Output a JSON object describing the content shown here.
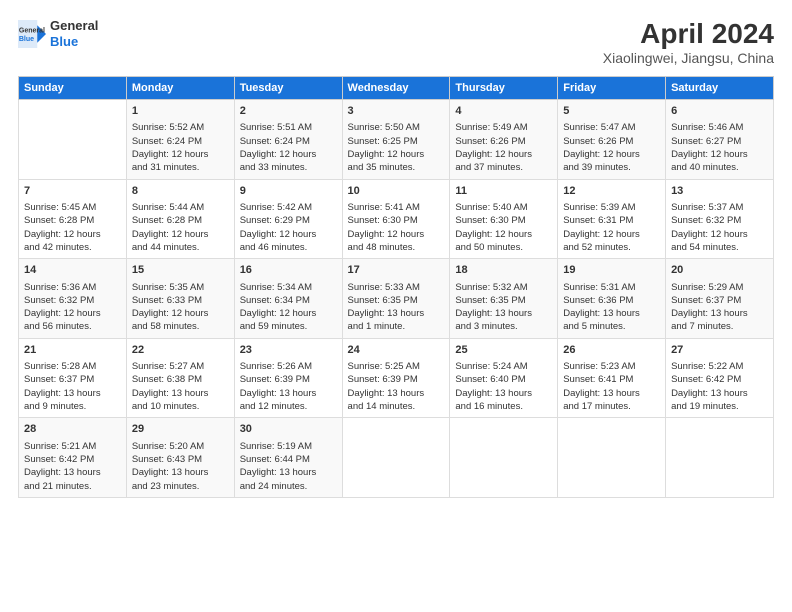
{
  "header": {
    "logo_line1": "General",
    "logo_line2": "Blue",
    "title": "April 2024",
    "subtitle": "Xiaolingwei, Jiangsu, China"
  },
  "columns": [
    "Sunday",
    "Monday",
    "Tuesday",
    "Wednesday",
    "Thursday",
    "Friday",
    "Saturday"
  ],
  "rows": [
    [
      {
        "num": "",
        "lines": []
      },
      {
        "num": "1",
        "lines": [
          "Sunrise: 5:52 AM",
          "Sunset: 6:24 PM",
          "Daylight: 12 hours",
          "and 31 minutes."
        ]
      },
      {
        "num": "2",
        "lines": [
          "Sunrise: 5:51 AM",
          "Sunset: 6:24 PM",
          "Daylight: 12 hours",
          "and 33 minutes."
        ]
      },
      {
        "num": "3",
        "lines": [
          "Sunrise: 5:50 AM",
          "Sunset: 6:25 PM",
          "Daylight: 12 hours",
          "and 35 minutes."
        ]
      },
      {
        "num": "4",
        "lines": [
          "Sunrise: 5:49 AM",
          "Sunset: 6:26 PM",
          "Daylight: 12 hours",
          "and 37 minutes."
        ]
      },
      {
        "num": "5",
        "lines": [
          "Sunrise: 5:47 AM",
          "Sunset: 6:26 PM",
          "Daylight: 12 hours",
          "and 39 minutes."
        ]
      },
      {
        "num": "6",
        "lines": [
          "Sunrise: 5:46 AM",
          "Sunset: 6:27 PM",
          "Daylight: 12 hours",
          "and 40 minutes."
        ]
      }
    ],
    [
      {
        "num": "7",
        "lines": [
          "Sunrise: 5:45 AM",
          "Sunset: 6:28 PM",
          "Daylight: 12 hours",
          "and 42 minutes."
        ]
      },
      {
        "num": "8",
        "lines": [
          "Sunrise: 5:44 AM",
          "Sunset: 6:28 PM",
          "Daylight: 12 hours",
          "and 44 minutes."
        ]
      },
      {
        "num": "9",
        "lines": [
          "Sunrise: 5:42 AM",
          "Sunset: 6:29 PM",
          "Daylight: 12 hours",
          "and 46 minutes."
        ]
      },
      {
        "num": "10",
        "lines": [
          "Sunrise: 5:41 AM",
          "Sunset: 6:30 PM",
          "Daylight: 12 hours",
          "and 48 minutes."
        ]
      },
      {
        "num": "11",
        "lines": [
          "Sunrise: 5:40 AM",
          "Sunset: 6:30 PM",
          "Daylight: 12 hours",
          "and 50 minutes."
        ]
      },
      {
        "num": "12",
        "lines": [
          "Sunrise: 5:39 AM",
          "Sunset: 6:31 PM",
          "Daylight: 12 hours",
          "and 52 minutes."
        ]
      },
      {
        "num": "13",
        "lines": [
          "Sunrise: 5:37 AM",
          "Sunset: 6:32 PM",
          "Daylight: 12 hours",
          "and 54 minutes."
        ]
      }
    ],
    [
      {
        "num": "14",
        "lines": [
          "Sunrise: 5:36 AM",
          "Sunset: 6:32 PM",
          "Daylight: 12 hours",
          "and 56 minutes."
        ]
      },
      {
        "num": "15",
        "lines": [
          "Sunrise: 5:35 AM",
          "Sunset: 6:33 PM",
          "Daylight: 12 hours",
          "and 58 minutes."
        ]
      },
      {
        "num": "16",
        "lines": [
          "Sunrise: 5:34 AM",
          "Sunset: 6:34 PM",
          "Daylight: 12 hours",
          "and 59 minutes."
        ]
      },
      {
        "num": "17",
        "lines": [
          "Sunrise: 5:33 AM",
          "Sunset: 6:35 PM",
          "Daylight: 13 hours",
          "and 1 minute."
        ]
      },
      {
        "num": "18",
        "lines": [
          "Sunrise: 5:32 AM",
          "Sunset: 6:35 PM",
          "Daylight: 13 hours",
          "and 3 minutes."
        ]
      },
      {
        "num": "19",
        "lines": [
          "Sunrise: 5:31 AM",
          "Sunset: 6:36 PM",
          "Daylight: 13 hours",
          "and 5 minutes."
        ]
      },
      {
        "num": "20",
        "lines": [
          "Sunrise: 5:29 AM",
          "Sunset: 6:37 PM",
          "Daylight: 13 hours",
          "and 7 minutes."
        ]
      }
    ],
    [
      {
        "num": "21",
        "lines": [
          "Sunrise: 5:28 AM",
          "Sunset: 6:37 PM",
          "Daylight: 13 hours",
          "and 9 minutes."
        ]
      },
      {
        "num": "22",
        "lines": [
          "Sunrise: 5:27 AM",
          "Sunset: 6:38 PM",
          "Daylight: 13 hours",
          "and 10 minutes."
        ]
      },
      {
        "num": "23",
        "lines": [
          "Sunrise: 5:26 AM",
          "Sunset: 6:39 PM",
          "Daylight: 13 hours",
          "and 12 minutes."
        ]
      },
      {
        "num": "24",
        "lines": [
          "Sunrise: 5:25 AM",
          "Sunset: 6:39 PM",
          "Daylight: 13 hours",
          "and 14 minutes."
        ]
      },
      {
        "num": "25",
        "lines": [
          "Sunrise: 5:24 AM",
          "Sunset: 6:40 PM",
          "Daylight: 13 hours",
          "and 16 minutes."
        ]
      },
      {
        "num": "26",
        "lines": [
          "Sunrise: 5:23 AM",
          "Sunset: 6:41 PM",
          "Daylight: 13 hours",
          "and 17 minutes."
        ]
      },
      {
        "num": "27",
        "lines": [
          "Sunrise: 5:22 AM",
          "Sunset: 6:42 PM",
          "Daylight: 13 hours",
          "and 19 minutes."
        ]
      }
    ],
    [
      {
        "num": "28",
        "lines": [
          "Sunrise: 5:21 AM",
          "Sunset: 6:42 PM",
          "Daylight: 13 hours",
          "and 21 minutes."
        ]
      },
      {
        "num": "29",
        "lines": [
          "Sunrise: 5:20 AM",
          "Sunset: 6:43 PM",
          "Daylight: 13 hours",
          "and 23 minutes."
        ]
      },
      {
        "num": "30",
        "lines": [
          "Sunrise: 5:19 AM",
          "Sunset: 6:44 PM",
          "Daylight: 13 hours",
          "and 24 minutes."
        ]
      },
      {
        "num": "",
        "lines": []
      },
      {
        "num": "",
        "lines": []
      },
      {
        "num": "",
        "lines": []
      },
      {
        "num": "",
        "lines": []
      }
    ]
  ]
}
